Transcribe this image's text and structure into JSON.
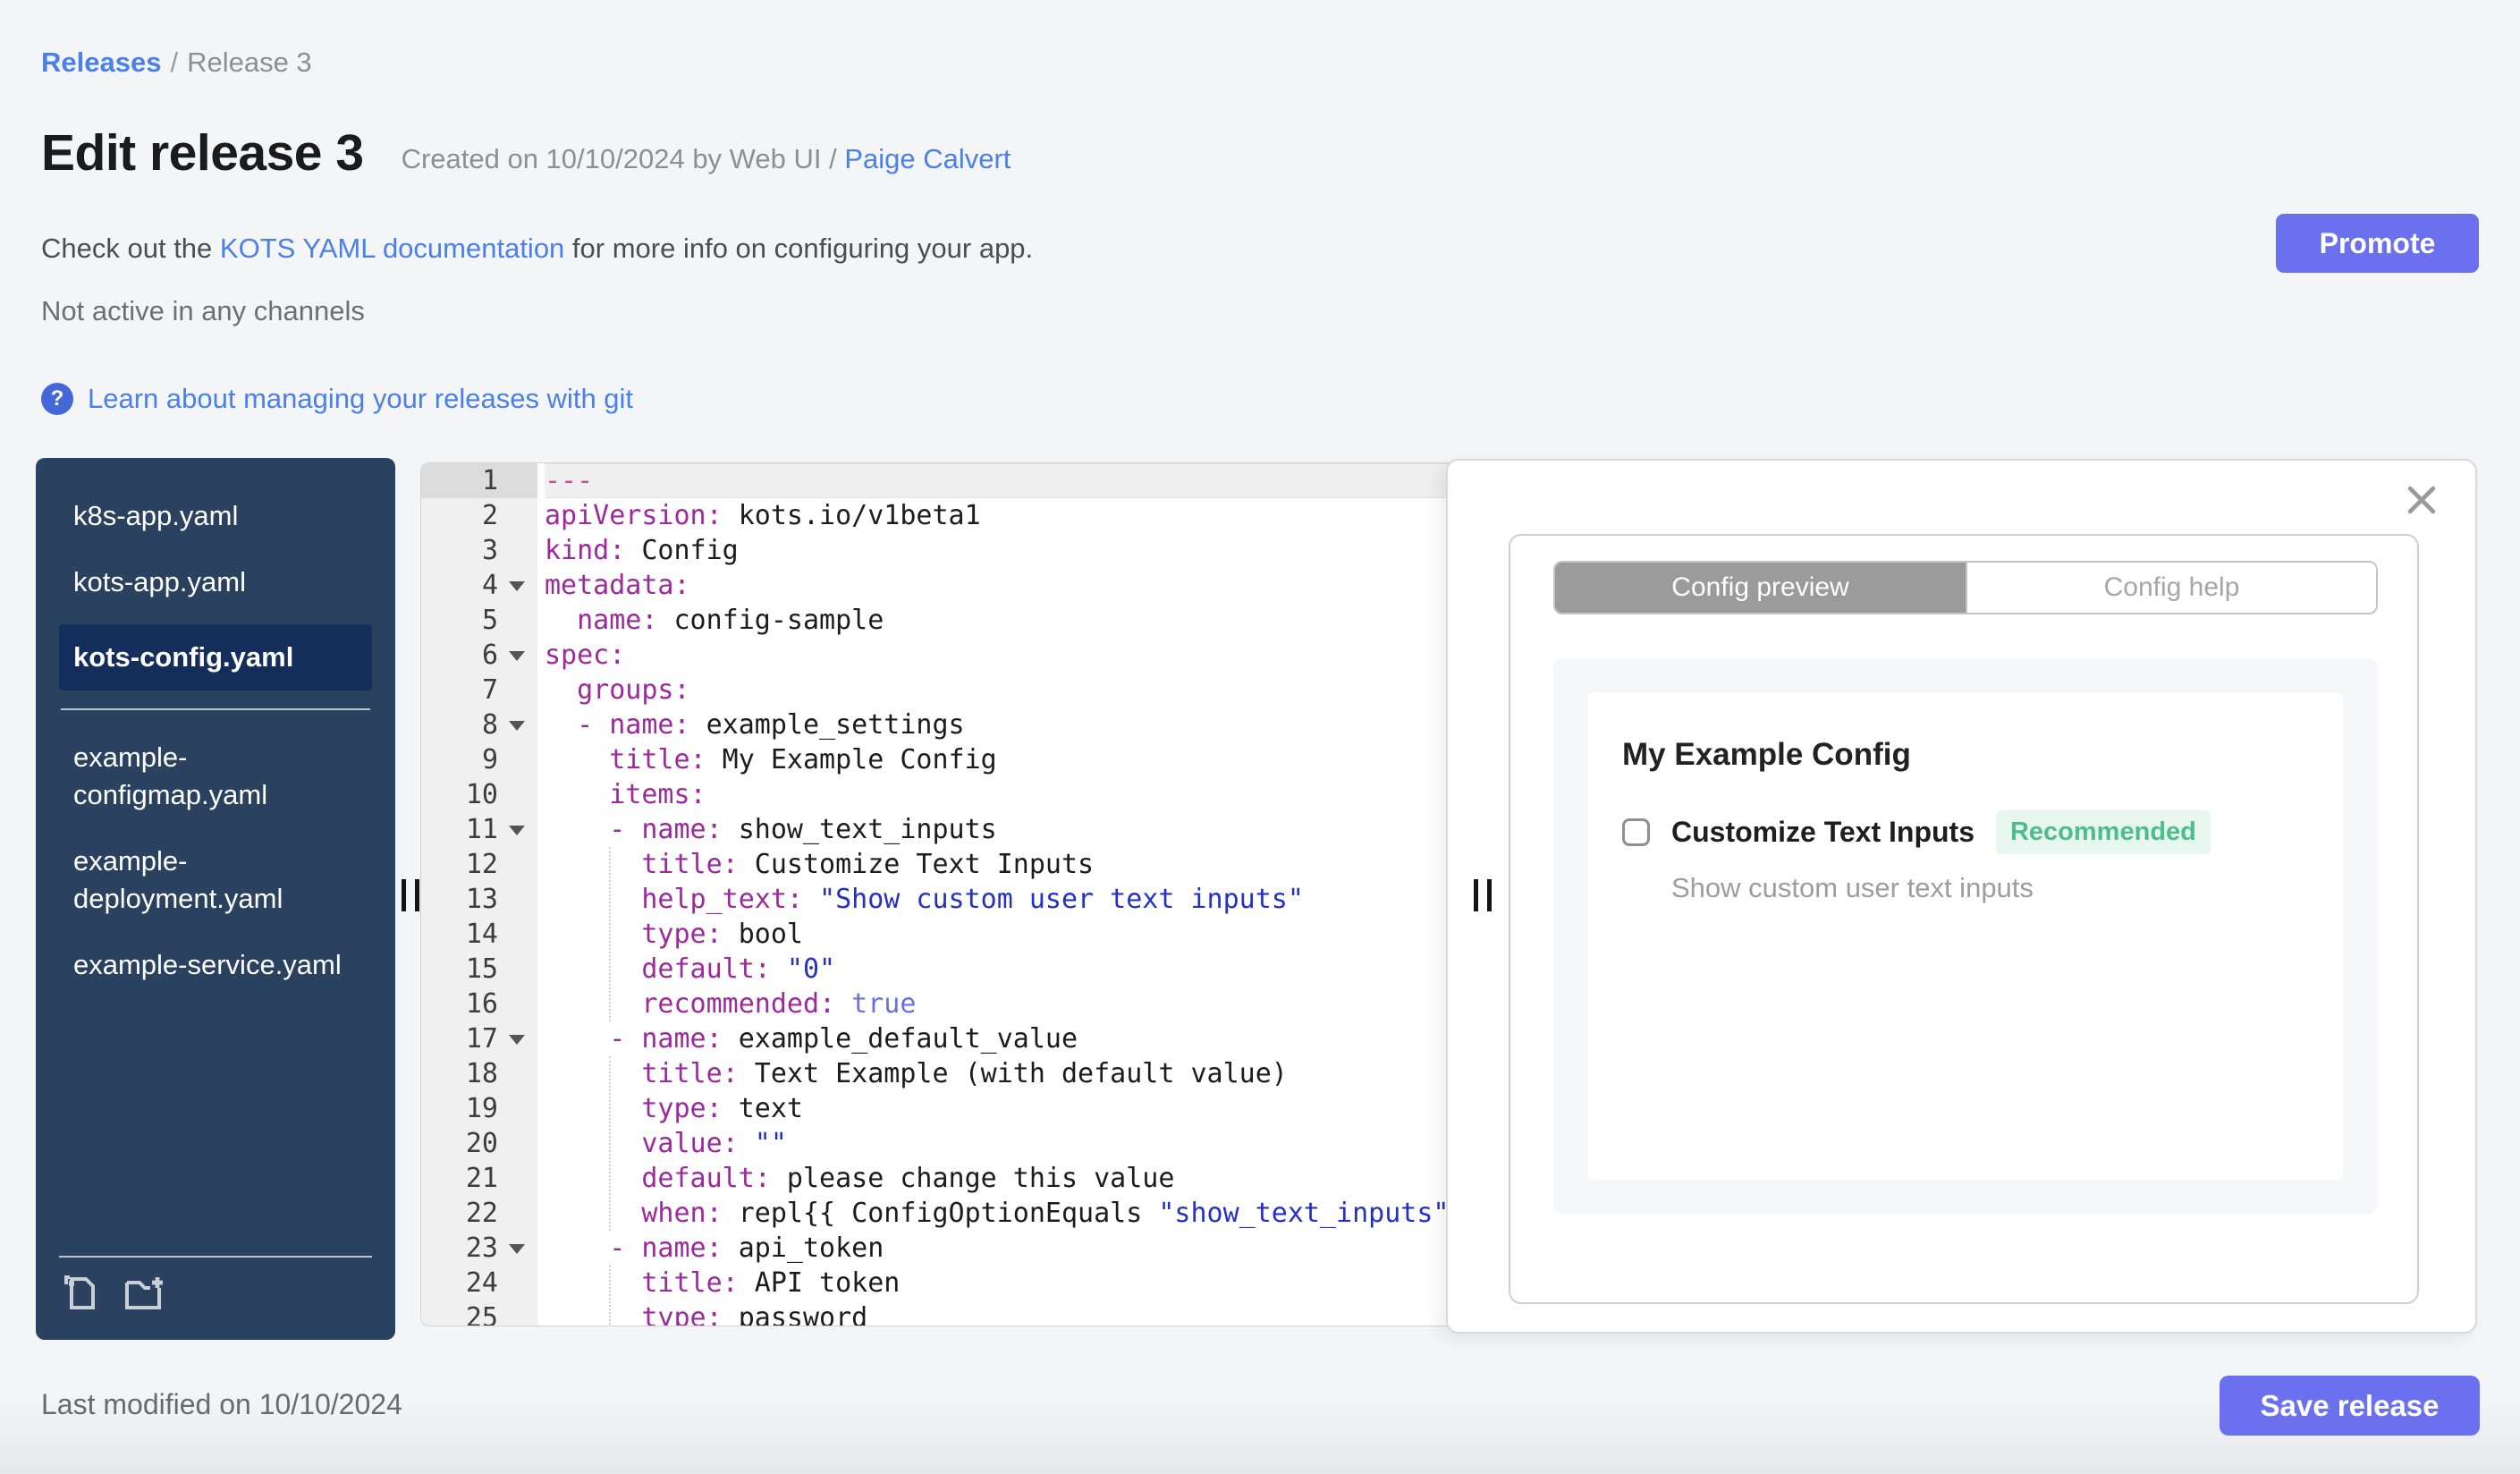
{
  "breadcrumb": {
    "link": "Releases",
    "separator": "/",
    "current": "Release 3"
  },
  "header": {
    "title": "Edit release 3",
    "created_prefix": "Created on 10/10/2024 by Web UI / ",
    "created_author": "Paige Calvert",
    "doc_prefix": "Check out the ",
    "doc_link": "KOTS YAML documentation",
    "doc_suffix": " for more info on configuring your app.",
    "promote_label": "Promote",
    "channel_status": "Not active in any channels",
    "help_icon_glyph": "?",
    "git_link": "Learn about managing your releases with git"
  },
  "sidebar": {
    "files": [
      {
        "name": "k8s-app.yaml",
        "selected": false
      },
      {
        "name": "kots-app.yaml",
        "selected": false
      },
      {
        "name": "kots-config.yaml",
        "selected": true
      },
      {
        "name": "example-configmap.yaml",
        "selected": false
      },
      {
        "name": "example-deployment.yaml",
        "selected": false
      },
      {
        "name": "example-service.yaml",
        "selected": false
      }
    ],
    "divider_after_index": 2,
    "icons": [
      "new-file-icon",
      "new-folder-icon"
    ]
  },
  "editor": {
    "active_line": 1,
    "fold_lines": [
      4,
      6,
      8,
      11,
      17,
      23
    ],
    "indent_guides": [
      {
        "ch": 4,
        "from": 12,
        "to": 16
      },
      {
        "ch": 4,
        "from": 18,
        "to": 22
      },
      {
        "ch": 4,
        "from": 24,
        "to": 25
      }
    ],
    "lines": [
      {
        "n": 1,
        "tokens": [
          [
            "doc",
            "---"
          ]
        ]
      },
      {
        "n": 2,
        "tokens": [
          [
            "key",
            "apiVersion:"
          ],
          [
            "val",
            " kots.io/v1beta1"
          ]
        ]
      },
      {
        "n": 3,
        "tokens": [
          [
            "key",
            "kind:"
          ],
          [
            "val",
            " Config"
          ]
        ]
      },
      {
        "n": 4,
        "tokens": [
          [
            "key",
            "metadata:"
          ]
        ]
      },
      {
        "n": 5,
        "tokens": [
          [
            "val",
            "  "
          ],
          [
            "key",
            "name:"
          ],
          [
            "val",
            " config-sample"
          ]
        ]
      },
      {
        "n": 6,
        "tokens": [
          [
            "key",
            "spec:"
          ]
        ]
      },
      {
        "n": 7,
        "tokens": [
          [
            "val",
            "  "
          ],
          [
            "key",
            "groups:"
          ]
        ]
      },
      {
        "n": 8,
        "tokens": [
          [
            "val",
            "  "
          ],
          [
            "key",
            "- name:"
          ],
          [
            "val",
            " example_settings"
          ]
        ]
      },
      {
        "n": 9,
        "tokens": [
          [
            "val",
            "    "
          ],
          [
            "key",
            "title:"
          ],
          [
            "val",
            " My Example Config"
          ]
        ]
      },
      {
        "n": 10,
        "tokens": [
          [
            "val",
            "    "
          ],
          [
            "key",
            "items:"
          ]
        ]
      },
      {
        "n": 11,
        "tokens": [
          [
            "val",
            "    "
          ],
          [
            "key",
            "- name:"
          ],
          [
            "val",
            " show_text_inputs"
          ]
        ]
      },
      {
        "n": 12,
        "tokens": [
          [
            "val",
            "      "
          ],
          [
            "key",
            "title:"
          ],
          [
            "val",
            " Customize Text Inputs"
          ]
        ]
      },
      {
        "n": 13,
        "tokens": [
          [
            "val",
            "      "
          ],
          [
            "key",
            "help_text:"
          ],
          [
            "str",
            " \"Show custom user text inputs\""
          ]
        ]
      },
      {
        "n": 14,
        "tokens": [
          [
            "val",
            "      "
          ],
          [
            "key",
            "type:"
          ],
          [
            "val",
            " bool"
          ]
        ]
      },
      {
        "n": 15,
        "tokens": [
          [
            "val",
            "      "
          ],
          [
            "key",
            "default:"
          ],
          [
            "str",
            " \"0\""
          ]
        ]
      },
      {
        "n": 16,
        "tokens": [
          [
            "val",
            "      "
          ],
          [
            "key",
            "recommended:"
          ],
          [
            "bool",
            " true"
          ]
        ]
      },
      {
        "n": 17,
        "tokens": [
          [
            "val",
            "    "
          ],
          [
            "key",
            "- name:"
          ],
          [
            "val",
            " example_default_value"
          ]
        ]
      },
      {
        "n": 18,
        "tokens": [
          [
            "val",
            "      "
          ],
          [
            "key",
            "title:"
          ],
          [
            "val",
            " Text Example (with default value)"
          ]
        ]
      },
      {
        "n": 19,
        "tokens": [
          [
            "val",
            "      "
          ],
          [
            "key",
            "type:"
          ],
          [
            "val",
            " text"
          ]
        ]
      },
      {
        "n": 20,
        "tokens": [
          [
            "val",
            "      "
          ],
          [
            "key",
            "value:"
          ],
          [
            "str",
            " \"\""
          ]
        ]
      },
      {
        "n": 21,
        "tokens": [
          [
            "val",
            "      "
          ],
          [
            "key",
            "default:"
          ],
          [
            "val",
            " please change this value"
          ]
        ]
      },
      {
        "n": 22,
        "tokens": [
          [
            "val",
            "      "
          ],
          [
            "key",
            "when:"
          ],
          [
            "val",
            " repl{{ ConfigOptionEquals "
          ],
          [
            "str",
            "\"show_text_inputs\""
          ]
        ]
      },
      {
        "n": 23,
        "tokens": [
          [
            "val",
            "    "
          ],
          [
            "key",
            "- name:"
          ],
          [
            "val",
            " api_token"
          ]
        ]
      },
      {
        "n": 24,
        "tokens": [
          [
            "val",
            "      "
          ],
          [
            "key",
            "title:"
          ],
          [
            "val",
            " API token"
          ]
        ]
      },
      {
        "n": 25,
        "tokens": [
          [
            "val",
            "      "
          ],
          [
            "key",
            "type:"
          ],
          [
            "val",
            " password"
          ]
        ]
      }
    ]
  },
  "preview": {
    "tabs": [
      {
        "label": "Config preview",
        "active": true
      },
      {
        "label": "Config help",
        "active": false
      }
    ],
    "group_title": "My Example Config",
    "item": {
      "label": "Customize Text Inputs",
      "badge": "Recommended",
      "help": "Show custom user text inputs",
      "checked": false
    }
  },
  "footer": {
    "last_modified": "Last modified on 10/10/2024",
    "save_label": "Save release"
  },
  "colors": {
    "accent_button": "#6b70ee",
    "link": "#4a80e8",
    "sidebar_bg": "#2a4160",
    "sidebar_selected_bg": "#132e5a",
    "badge_bg": "#e7f6ef",
    "badge_text": "#4fbd8b",
    "code_key": "#9c2a9c",
    "code_string": "#2431c4",
    "code_bool": "#6a71dd",
    "code_doc": "#c74b96"
  }
}
